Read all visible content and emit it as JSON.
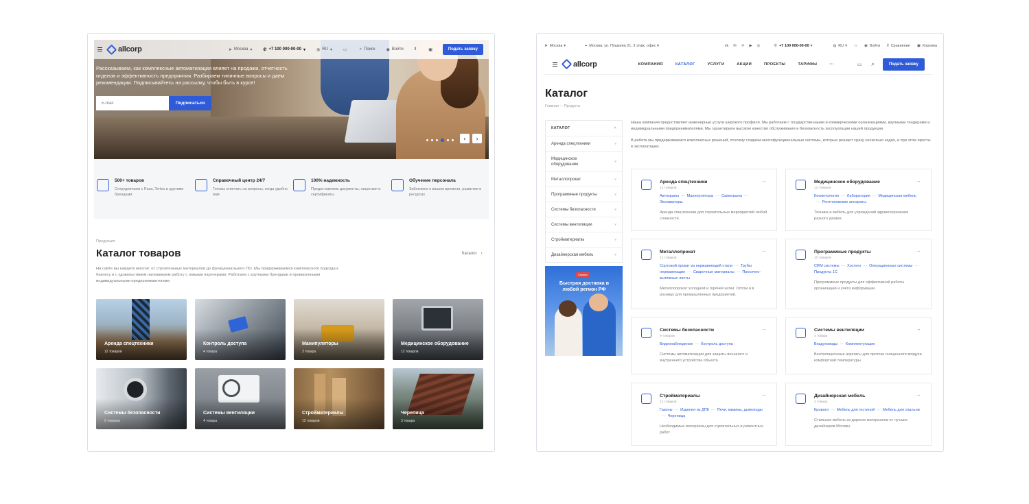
{
  "left": {
    "topbar": {
      "logo": "allcorp",
      "city": "Москва",
      "phone": "+7 100 000-00-00",
      "lang": "RU",
      "search": "Поиск",
      "login": "Войти",
      "cta": "Подать заявку"
    },
    "hero": {
      "text": "Рассказываем, как комплексные автоматизации влияет на продажи, отчетность отделов и эффективность предприятия. Разбираем типичные вопросы и даем рекомендации. Подписывайтесь на рассылку, чтобы быть в курсе!",
      "email_placeholder": "E-mail",
      "subscribe": "Подписаться",
      "prev": "‹",
      "next": "›"
    },
    "features": [
      {
        "title": "500+ товаров",
        "desc": "Сотрудничаем с Pasa, Tertos и другими брендами"
      },
      {
        "title": "Справочный центр 24/7",
        "desc": "Готовы отвечать на вопросы, когда удобно вам"
      },
      {
        "title": "100% надежность",
        "desc": "Предоставляем документы, лицензии и сертификаты"
      },
      {
        "title": "Обучение персонала",
        "desc": "Заботимся о вашем времени, развитии и ресурсах"
      }
    ],
    "catalog": {
      "subtitle": "Продукция",
      "title": "Каталог товаров",
      "link": "Каталог",
      "desc": "На сайте вы найдете многое: от строительных материалов до функционального ПО. Мы придерживаемся комплексного подхода к бизнесу и с удовольствием налаживаем работу с новыми партнерами. Работаем с крупными брендами и проверенными индивидуальными предпринимателями."
    },
    "tiles": [
      {
        "name": "Аренда спецтехники",
        "count": "12 товаров"
      },
      {
        "name": "Контроль доступа",
        "count": "4 товара"
      },
      {
        "name": "Манипуляторы",
        "count": "3 товара"
      },
      {
        "name": "Медицинское оборудование",
        "count": "12 товаров"
      },
      {
        "name": "Системы безопасности",
        "count": "9 товаров"
      },
      {
        "name": "Системы вентиляции",
        "count": "4 товара"
      },
      {
        "name": "Стройматериалы",
        "count": "12 товаров"
      },
      {
        "name": "Черепица",
        "count": "3 товара"
      }
    ]
  },
  "right": {
    "topbar": {
      "city": "Москва",
      "address": "Москва, ул. Пушкина 21, 3 этаж, офис 4",
      "phone": "+7 100 000-00-00",
      "lang": "RU",
      "login": "Войти",
      "compare": "Сравнение",
      "cart": "Корзина"
    },
    "nav": {
      "logo": "allcorp",
      "items": [
        "КОМПАНИЯ",
        "КАТАЛОГ",
        "УСЛУГИ",
        "АКЦИИ",
        "ПРОЕКТЫ",
        "ТАРИФЫ",
        "···"
      ],
      "cta": "Подать заявку"
    },
    "title": "Каталог",
    "breadcrumbs": "Главная — Продукты",
    "sidebar": [
      "КАТАЛОГ",
      "Аренда спецтехники",
      "Медицинское оборудование",
      "Металлопрокат",
      "Программные продукты",
      "Системы безопасности",
      "Системы вентиляции",
      "Стройматериалы",
      "Дизайнерская мебель"
    ],
    "promo": {
      "badge": "Сервис",
      "text": "Быстрая доставка в любой регион РФ"
    },
    "intro": [
      "Наша компания предоставляет инженерные услуги широкого профиля. Мы работаем с государственными и коммерческими организациями, крупными тендерами и индивидуальными предпринимателями. Мы гарантируем высокое качество обслуживания и безопасность эксплуатации нашей продукции.",
      "В работе мы придерживаемся комплексных решений, поэтому создаем многофункциональные системы, которые решают сразу несколько задач, и при этом просты в эксплуатации."
    ],
    "cards": [
      {
        "title": "Аренда спецтехники",
        "count": "12 товаров",
        "links": [
          "Автокраны",
          "Манипуляторы",
          "Самосвалы",
          "Экскаваторы"
        ],
        "desc": "Аренда спецтехники для строительных мероприятий любой сложности."
      },
      {
        "title": "Медицинское оборудование",
        "count": "12 товаров",
        "links": [
          "Косметология",
          "Лаборатория",
          "Медицинская мебель",
          "Рентгеновские аппараты"
        ],
        "desc": "Техника и мебель для учреждений здравоохранения разного уровня."
      },
      {
        "title": "Металлопрокат",
        "count": "12 товаров",
        "links": [
          "Сортовой прокат из нержавеющей стали",
          "Трубы нержавеющие",
          "Сварочные материалы",
          "Просечно-вытяжные листы"
        ],
        "desc": "Металлопрокат холодной и горячей катки. Оптом и в розницу для промышленных предприятий."
      },
      {
        "title": "Программные продукты",
        "count": "10 товаров",
        "links": [
          "CRM системы",
          "Хостинг",
          "Операционные системы",
          "Продукты 1С"
        ],
        "desc": "Программные продукты для эффективной работы организации и учета информации."
      },
      {
        "title": "Системы безопасности",
        "count": "9 товаров",
        "links": [
          "Видеонаблюдение",
          "Контроль доступа"
        ],
        "desc": "Системы автоматизации для защиты внешнего и внутреннего устройства объекта."
      },
      {
        "title": "Системы вентиляции",
        "count": "4 товара",
        "links": [
          "Воздуховоды",
          "Комплектующие"
        ],
        "desc": "Вентиляционные агрегаты для притока очищенного воздуха комфортной температуры."
      },
      {
        "title": "Стройматериалы",
        "count": "12 товаров",
        "links": [
          "Газоны",
          "Изделия из ДПК",
          "Печи, камины, дымоходы",
          "Черепица"
        ],
        "desc": "Необходимые материалы для строительных и ремонтных работ."
      },
      {
        "title": "Дизайнерская мебель",
        "count": "3 товара",
        "links": [
          "Кровати",
          "Мебель для гостиной",
          "Мебель для спальни"
        ],
        "desc": "Стильная мебель из дорогих материалов от лучших дизайнеров Москвы."
      }
    ]
  },
  "colors": {
    "accent": "#2f5bd8",
    "border": "#e5e7eb",
    "muted": "#777777"
  }
}
